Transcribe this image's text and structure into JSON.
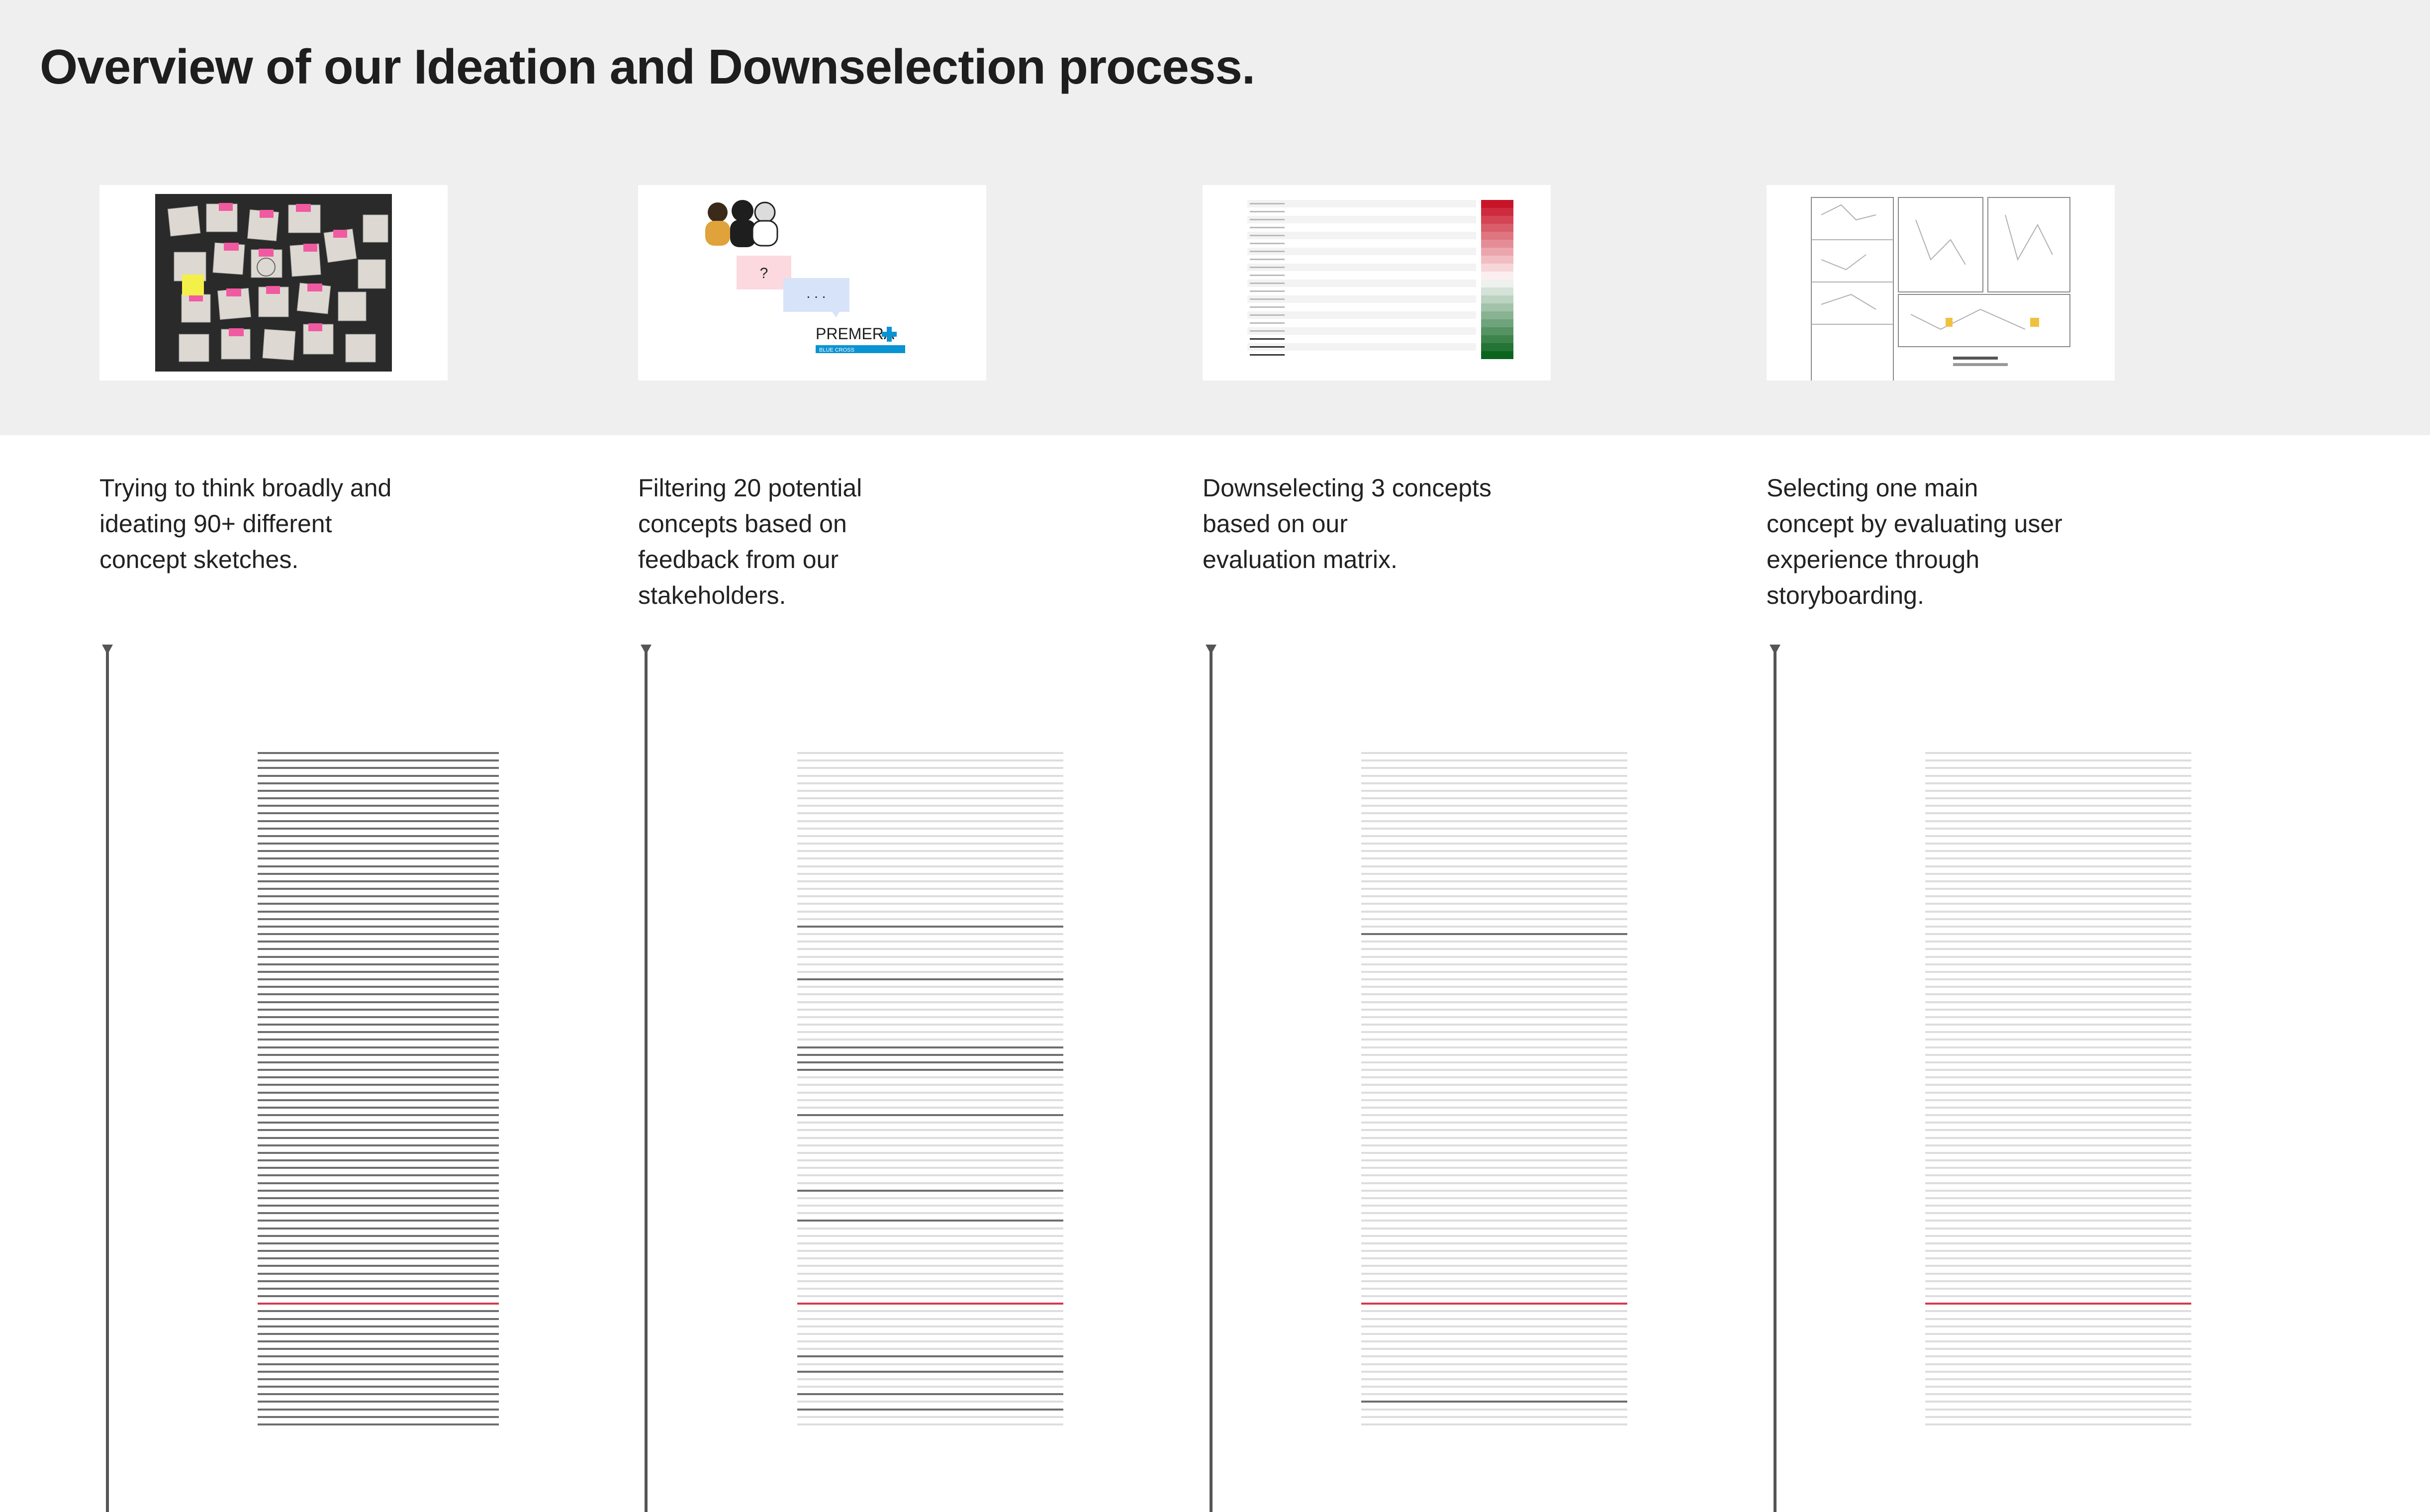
{
  "title": "Overview of our Ideation and Downselection process.",
  "colors": {
    "band": "#efefef",
    "line_faint": "#dddddd",
    "line_strong": "#6e6e6e",
    "line_highlight": "#d23a4d",
    "sticky_pink": "#f05aa0",
    "sticky_yellow": "#f4f04a",
    "brand_blue": "#0a93d2"
  },
  "stages": [
    {
      "name": "ideation",
      "description": [
        "Trying to think broadly and",
        "ideating 90+ different",
        "concept sketches."
      ],
      "thumbnail_icon": "sticky-notes-photo-icon"
    },
    {
      "name": "filtering",
      "description": [
        "Filtering 20 potential",
        "concepts based on",
        "feedback from our",
        "stakeholders."
      ],
      "thumbnail_icon": "stakeholder-chat-icon",
      "thumbnail": {
        "question_mark": "?",
        "ellipsis": ". . .",
        "logo_text": "PREMERA",
        "logo_subtext": "BLUE CROSS"
      }
    },
    {
      "name": "downselection",
      "description": [
        "Downselecting 3 concepts",
        "based on our",
        "evaluation matrix."
      ],
      "thumbnail_icon": "evaluation-matrix-icon"
    },
    {
      "name": "selection",
      "description": [
        "Selecting one main",
        "concept by evaluating user",
        "experience through",
        "storyboarding."
      ],
      "thumbnail_icon": "storyboard-icon"
    }
  ],
  "concept_stacks": [
    {
      "total": 90,
      "strong_indices": "all",
      "highlight_index": 73
    },
    {
      "total": 90,
      "strong_indices": [
        23,
        30,
        39,
        40,
        41,
        42,
        48,
        58,
        62,
        73,
        80,
        82,
        85,
        87,
        94,
        98
      ],
      "highlight_index": 73
    },
    {
      "total": 90,
      "strong_indices": [
        24,
        86
      ],
      "highlight_index": 73
    },
    {
      "total": 90,
      "strong_indices": [],
      "highlight_index": 73
    }
  ]
}
